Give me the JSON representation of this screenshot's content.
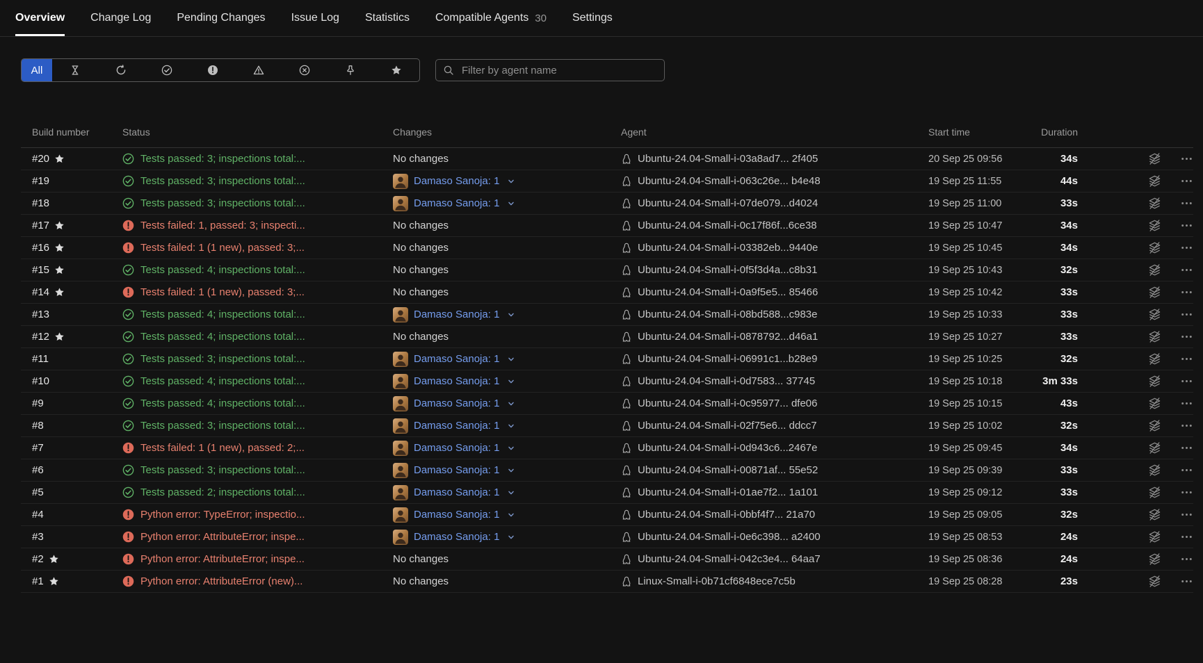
{
  "colors": {
    "background": "#131313",
    "accent_blue": "#2c5cc5",
    "link_blue": "#759dee",
    "success_green": "#60b266",
    "failure_red": "#e8816f"
  },
  "tabs": [
    {
      "label": "Overview",
      "active": true
    },
    {
      "label": "Change Log",
      "active": false
    },
    {
      "label": "Pending Changes",
      "active": false
    },
    {
      "label": "Issue Log",
      "active": false
    },
    {
      "label": "Statistics",
      "active": false
    },
    {
      "label": "Compatible Agents",
      "badge": "30",
      "active": false
    },
    {
      "label": "Settings",
      "active": false
    }
  ],
  "filter": {
    "all_label": "All",
    "status_icons": [
      "queued",
      "running",
      "successful",
      "failed",
      "warning",
      "canceled",
      "pinned",
      "starred"
    ],
    "search_placeholder": "Filter by agent name"
  },
  "table": {
    "columns": [
      "Build number",
      "Status",
      "Changes",
      "Agent",
      "Start time",
      "Duration"
    ],
    "rows": [
      {
        "build": "#20",
        "starred": true,
        "status": {
          "type": "success",
          "text": "Tests passed: 3; inspections total:..."
        },
        "changes": {
          "type": "none",
          "label": "No changes"
        },
        "agent": "Ubuntu-24.04-Small-i-03a8ad7... 2f405",
        "start": "20 Sep 25 09:56",
        "duration": "34s"
      },
      {
        "build": "#19",
        "starred": false,
        "status": {
          "type": "success",
          "text": "Tests passed: 3; inspections total:..."
        },
        "changes": {
          "type": "user",
          "label": "Damaso Sanoja: 1"
        },
        "agent": "Ubuntu-24.04-Small-i-063c26e... b4e48",
        "start": "19 Sep 25 11:55",
        "duration": "44s"
      },
      {
        "build": "#18",
        "starred": false,
        "status": {
          "type": "success",
          "text": "Tests passed: 3; inspections total:..."
        },
        "changes": {
          "type": "user",
          "label": "Damaso Sanoja: 1"
        },
        "agent": "Ubuntu-24.04-Small-i-07de079...d4024",
        "start": "19 Sep 25 11:00",
        "duration": "33s"
      },
      {
        "build": "#17",
        "starred": true,
        "status": {
          "type": "failure",
          "text": "Tests failed: 1, passed: 3; inspecti..."
        },
        "changes": {
          "type": "none",
          "label": "No changes"
        },
        "agent": "Ubuntu-24.04-Small-i-0c17f86f...6ce38",
        "start": "19 Sep 25 10:47",
        "duration": "34s"
      },
      {
        "build": "#16",
        "starred": true,
        "status": {
          "type": "failure",
          "text": "Tests failed: 1 (1 new), passed: 3;..."
        },
        "changes": {
          "type": "none",
          "label": "No changes"
        },
        "agent": "Ubuntu-24.04-Small-i-03382eb...9440e",
        "start": "19 Sep 25 10:45",
        "duration": "34s"
      },
      {
        "build": "#15",
        "starred": true,
        "status": {
          "type": "success",
          "text": "Tests passed: 4; inspections total:..."
        },
        "changes": {
          "type": "none",
          "label": "No changes"
        },
        "agent": "Ubuntu-24.04-Small-i-0f5f3d4a...c8b31",
        "start": "19 Sep 25 10:43",
        "duration": "32s"
      },
      {
        "build": "#14",
        "starred": true,
        "status": {
          "type": "failure",
          "text": "Tests failed: 1 (1 new), passed: 3;..."
        },
        "changes": {
          "type": "none",
          "label": "No changes"
        },
        "agent": "Ubuntu-24.04-Small-i-0a9f5e5... 85466",
        "start": "19 Sep 25 10:42",
        "duration": "33s"
      },
      {
        "build": "#13",
        "starred": false,
        "status": {
          "type": "success",
          "text": "Tests passed: 4; inspections total:..."
        },
        "changes": {
          "type": "user",
          "label": "Damaso Sanoja: 1"
        },
        "agent": "Ubuntu-24.04-Small-i-08bd588...c983e",
        "start": "19 Sep 25 10:33",
        "duration": "33s"
      },
      {
        "build": "#12",
        "starred": true,
        "status": {
          "type": "success",
          "text": "Tests passed: 4; inspections total:..."
        },
        "changes": {
          "type": "none",
          "label": "No changes"
        },
        "agent": "Ubuntu-24.04-Small-i-0878792...d46a1",
        "start": "19 Sep 25 10:27",
        "duration": "33s"
      },
      {
        "build": "#11",
        "starred": false,
        "status": {
          "type": "success",
          "text": "Tests passed: 3; inspections total:..."
        },
        "changes": {
          "type": "user",
          "label": "Damaso Sanoja: 1"
        },
        "agent": "Ubuntu-24.04-Small-i-06991c1...b28e9",
        "start": "19 Sep 25 10:25",
        "duration": "32s"
      },
      {
        "build": "#10",
        "starred": false,
        "status": {
          "type": "success",
          "text": "Tests passed: 4; inspections total:..."
        },
        "changes": {
          "type": "user",
          "label": "Damaso Sanoja: 1"
        },
        "agent": "Ubuntu-24.04-Small-i-0d7583... 37745",
        "start": "19 Sep 25 10:18",
        "duration": "3m 33s"
      },
      {
        "build": "#9",
        "starred": false,
        "status": {
          "type": "success",
          "text": "Tests passed: 4; inspections total:..."
        },
        "changes": {
          "type": "user",
          "label": "Damaso Sanoja: 1"
        },
        "agent": "Ubuntu-24.04-Small-i-0c95977... dfe06",
        "start": "19 Sep 25 10:15",
        "duration": "43s"
      },
      {
        "build": "#8",
        "starred": false,
        "status": {
          "type": "success",
          "text": "Tests passed: 3; inspections total:..."
        },
        "changes": {
          "type": "user",
          "label": "Damaso Sanoja: 1"
        },
        "agent": "Ubuntu-24.04-Small-i-02f75e6... ddcc7",
        "start": "19 Sep 25 10:02",
        "duration": "32s"
      },
      {
        "build": "#7",
        "starred": false,
        "status": {
          "type": "failure",
          "text": "Tests failed: 1 (1 new), passed: 2;..."
        },
        "changes": {
          "type": "user",
          "label": "Damaso Sanoja: 1"
        },
        "agent": "Ubuntu-24.04-Small-i-0d943c6...2467e",
        "start": "19 Sep 25 09:45",
        "duration": "34s"
      },
      {
        "build": "#6",
        "starred": false,
        "status": {
          "type": "success",
          "text": "Tests passed: 3; inspections total:..."
        },
        "changes": {
          "type": "user",
          "label": "Damaso Sanoja: 1"
        },
        "agent": "Ubuntu-24.04-Small-i-00871af... 55e52",
        "start": "19 Sep 25 09:39",
        "duration": "33s"
      },
      {
        "build": "#5",
        "starred": false,
        "status": {
          "type": "success",
          "text": "Tests passed: 2; inspections total:..."
        },
        "changes": {
          "type": "user",
          "label": "Damaso Sanoja: 1"
        },
        "agent": "Ubuntu-24.04-Small-i-01ae7f2... 1a101",
        "start": "19 Sep 25 09:12",
        "duration": "33s"
      },
      {
        "build": "#4",
        "starred": false,
        "status": {
          "type": "failure",
          "text": "Python error: TypeError; inspectio..."
        },
        "changes": {
          "type": "user",
          "label": "Damaso Sanoja: 1"
        },
        "agent": "Ubuntu-24.04-Small-i-0bbf4f7... 21a70",
        "start": "19 Sep 25 09:05",
        "duration": "32s"
      },
      {
        "build": "#3",
        "starred": false,
        "status": {
          "type": "failure",
          "text": "Python error: AttributeError; inspe..."
        },
        "changes": {
          "type": "user",
          "label": "Damaso Sanoja: 1"
        },
        "agent": "Ubuntu-24.04-Small-i-0e6c398... a2400",
        "start": "19 Sep 25 08:53",
        "duration": "24s"
      },
      {
        "build": "#2",
        "starred": true,
        "status": {
          "type": "failure",
          "text": "Python error: AttributeError; inspe..."
        },
        "changes": {
          "type": "none",
          "label": "No changes"
        },
        "agent": "Ubuntu-24.04-Small-i-042c3e4... 64aa7",
        "start": "19 Sep 25 08:36",
        "duration": "24s"
      },
      {
        "build": "#1",
        "starred": true,
        "status": {
          "type": "failure",
          "text": "Python error: AttributeError (new)..."
        },
        "changes": {
          "type": "none",
          "label": "No changes"
        },
        "agent": "Linux-Small-i-0b71cf6848ece7c5b",
        "start": "19 Sep 25 08:28",
        "duration": "23s"
      }
    ]
  }
}
